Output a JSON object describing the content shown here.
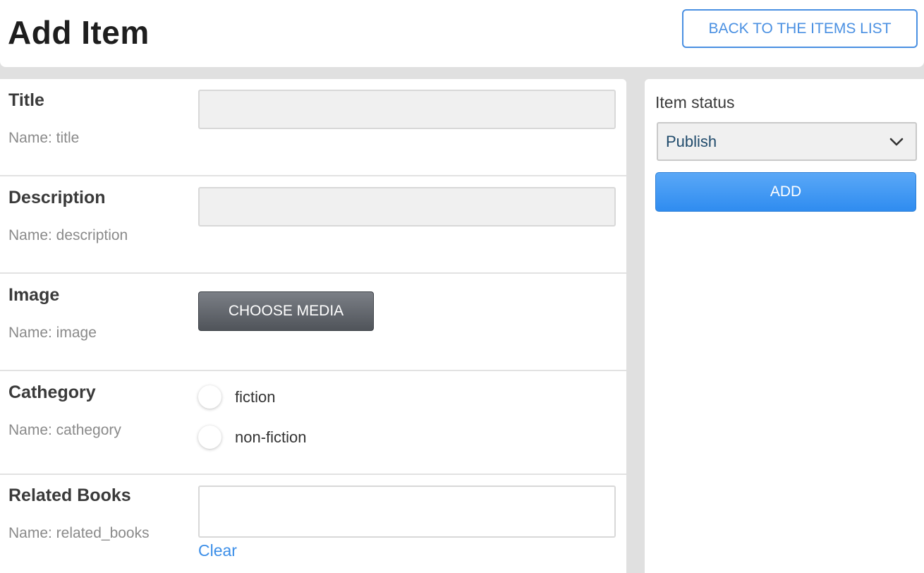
{
  "header": {
    "title": "Add Item",
    "back_button_label": "BACK TO THE ITEMS LIST"
  },
  "fields": {
    "title": {
      "label": "Title",
      "name": "Name: title",
      "value": ""
    },
    "description": {
      "label": "Description",
      "name": "Name: description",
      "value": ""
    },
    "image": {
      "label": "Image",
      "name": "Name: image",
      "button_label": "CHOOSE MEDIA"
    },
    "cathegory": {
      "label": "Cathegory",
      "name": "Name: cathegory",
      "options": [
        "fiction",
        "non-fiction"
      ],
      "selected": null
    },
    "related_books": {
      "label": "Related Books",
      "name": "Name: related_books",
      "clear_label": "Clear"
    }
  },
  "sidebar": {
    "status_label": "Item status",
    "status_value": "Publish",
    "add_button_label": "ADD"
  },
  "colors": {
    "accent": "#4a90e2",
    "primary_button": "#2f8cf0",
    "media_button": "#5c6066",
    "link": "#3b8ee8"
  },
  "icons": {
    "status_dropdown": "chevron-down-icon"
  }
}
